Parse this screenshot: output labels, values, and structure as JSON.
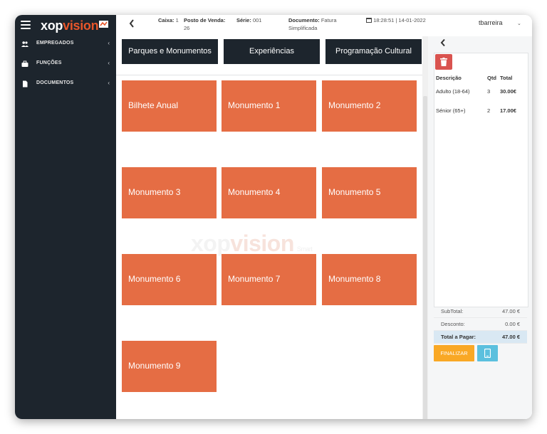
{
  "brand": {
    "logo_main": "xop",
    "logo_accent": "vision",
    "accent_color": "#e8562a",
    "sidebar_color": "#1d252d",
    "tile_color": "#e56d44"
  },
  "sidebar": {
    "items": [
      {
        "label": "EMPREGADOS",
        "icon": "users-icon"
      },
      {
        "label": "FUNÇÕES",
        "icon": "briefcase-icon"
      },
      {
        "label": "DOCUMENTOS",
        "icon": "document-icon"
      }
    ]
  },
  "header": {
    "caixa_label": "Caixa:",
    "caixa_value": "1",
    "posto_label": "Posto de Venda:",
    "posto_value": "26",
    "serie_label": "Série:",
    "serie_value": "001",
    "documento_label": "Documento:",
    "documento_value_1": "Fatura",
    "documento_value_2": "Simplificada",
    "datetime": "18:28:51 | 14-01-2022",
    "user": "tbarreira"
  },
  "categories": [
    "Parques e Monumentos",
    "Experiências",
    "Programação Cultural"
  ],
  "products": [
    "Bilhete Anual",
    "Monumento 1",
    "Monumento 2",
    "Monumento 3",
    "Monumento 4",
    "Monumento 5",
    "Monumento 6",
    "Monumento 7",
    "Monumento 8",
    "Monumento 9"
  ],
  "watermark": {
    "main": "xop",
    "accent": "vision",
    "tag": "Smart"
  },
  "cart": {
    "headers": {
      "description": "Descrição",
      "qty": "Qtd",
      "total": "Total"
    },
    "rows": [
      {
        "description": "Adulto (18-64)",
        "qty": "3",
        "total": "30.00€"
      },
      {
        "description": "Sénior (65+)",
        "qty": "2",
        "total": "17.00€"
      }
    ],
    "subtotal_label": "SubTotal:",
    "subtotal_value": "47.00 €",
    "discount_label": "Desconto:",
    "discount_value": "0.00 €",
    "total_label": "Total a Pagar:",
    "total_value": "47.00 €",
    "finalize_label": "FINALIZAR"
  }
}
